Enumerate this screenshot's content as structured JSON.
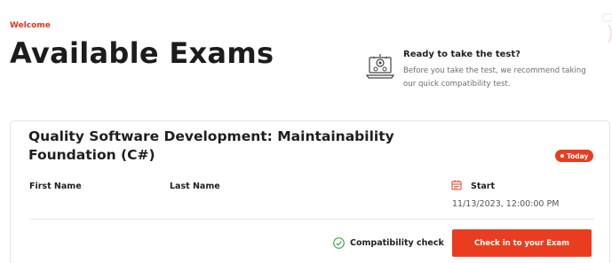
{
  "header": {
    "welcome": "Welcome",
    "title": "Available Exams"
  },
  "ready": {
    "icon": "laptop-gear-icon",
    "title": "Ready to take the test?",
    "text": "Before you take the test, we recommend taking our quick compatibility test."
  },
  "exam": {
    "name": "Quality Software Development: Maintainability Foundation (C#)",
    "badge": "Today",
    "first_name_label": "First Name",
    "last_name_label": "Last Name",
    "start_label": "Start",
    "start_value": "11/13/2023, 12:00:00 PM",
    "compatibility_label": "Compatibility check",
    "checkin_label": "Check in to your Exam"
  },
  "colors": {
    "accent": "#ea3d20",
    "success": "#3aa64b"
  }
}
